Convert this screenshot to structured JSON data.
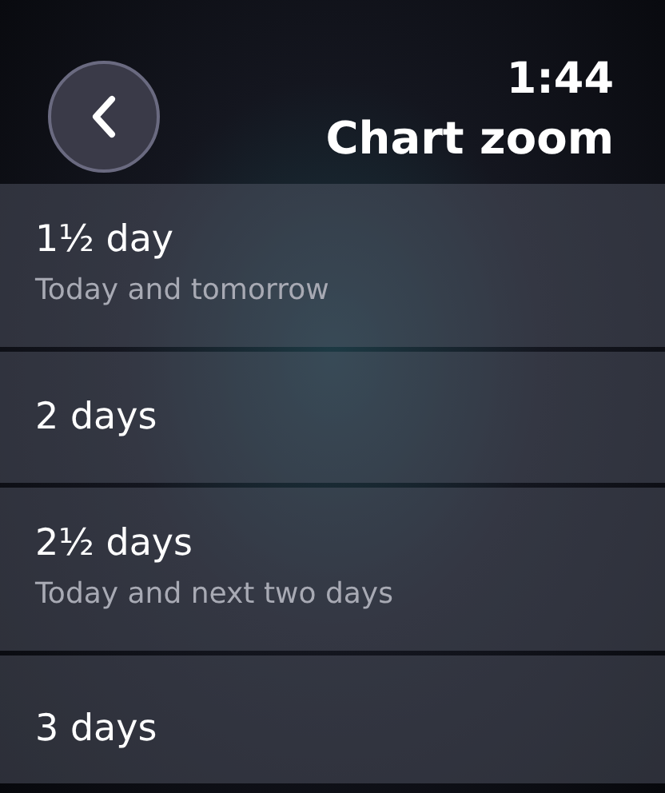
{
  "header": {
    "time": "1:44",
    "title": "Chart zoom"
  },
  "options": [
    {
      "label": "1½ day",
      "subtitle": "Today and tomorrow"
    },
    {
      "label": "2 days"
    },
    {
      "label": "2½ days",
      "subtitle": "Today and next two days"
    },
    {
      "label": "3 days"
    }
  ]
}
